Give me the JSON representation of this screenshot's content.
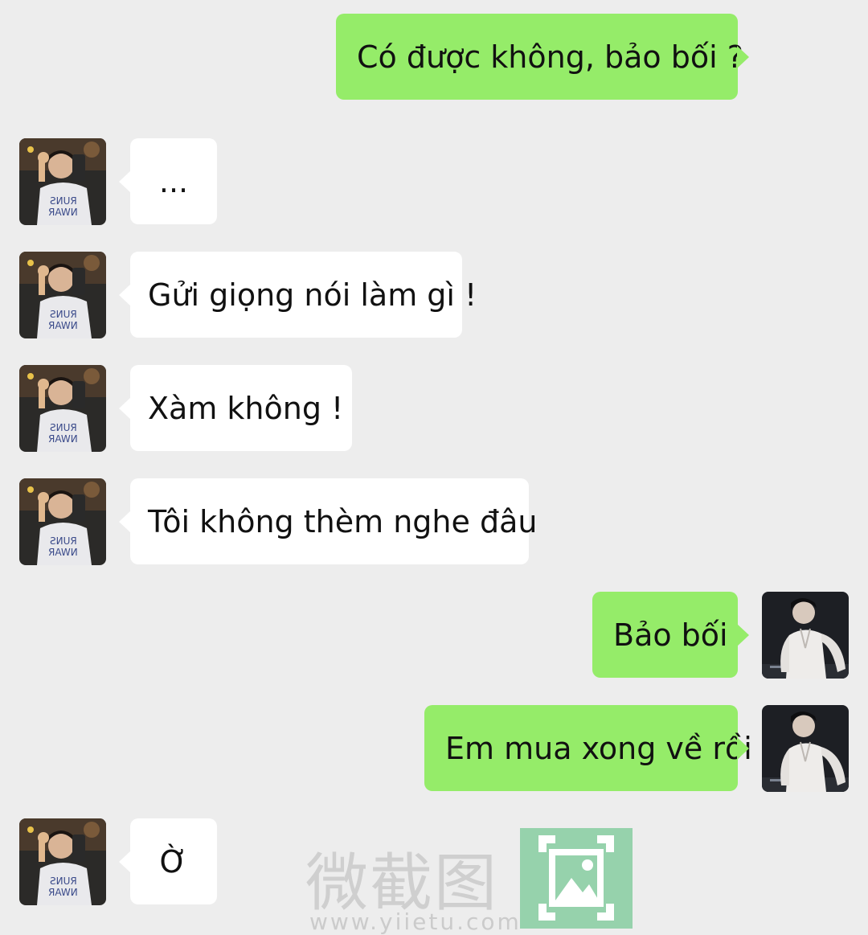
{
  "conversation": {
    "messages": [
      {
        "side": "out",
        "text": "Có được không, bảo bối ?"
      },
      {
        "side": "in",
        "text": "..."
      },
      {
        "side": "in",
        "text": "Gửi giọng nói làm gì !"
      },
      {
        "side": "in",
        "text": "Xàm không !"
      },
      {
        "side": "in",
        "text": "Tôi không thèm nghe đâu"
      },
      {
        "side": "out",
        "text": "Bảo bối"
      },
      {
        "side": "out",
        "text": "Em mua xong về rồi"
      },
      {
        "side": "in",
        "text": "Ờ"
      }
    ]
  },
  "watermark": {
    "brand": "微截图",
    "url": "www.yiietu.com",
    "icon": "image-crop-icon"
  },
  "colors": {
    "background": "#ededed",
    "outgoing_bubble": "#95ec69",
    "incoming_bubble": "#ffffff",
    "text": "#111111"
  }
}
